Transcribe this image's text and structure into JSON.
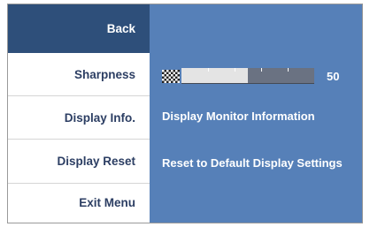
{
  "menu": {
    "items": [
      {
        "label": "Back",
        "selected": true
      },
      {
        "label": "Sharpness"
      },
      {
        "label": "Display Info."
      },
      {
        "label": "Display Reset"
      },
      {
        "label": "Exit Menu"
      }
    ]
  },
  "panel": {
    "sharpness": {
      "value": "50",
      "level_fraction": 0.5,
      "icon": "checkerboard-icon"
    },
    "display_info_text": "Display Monitor Information",
    "display_reset_text": "Reset to Default Display Settings"
  },
  "colors": {
    "selected_bg": "#2e4f7a",
    "panel_bg": "#5680b8",
    "menu_text": "#2c3e63"
  }
}
